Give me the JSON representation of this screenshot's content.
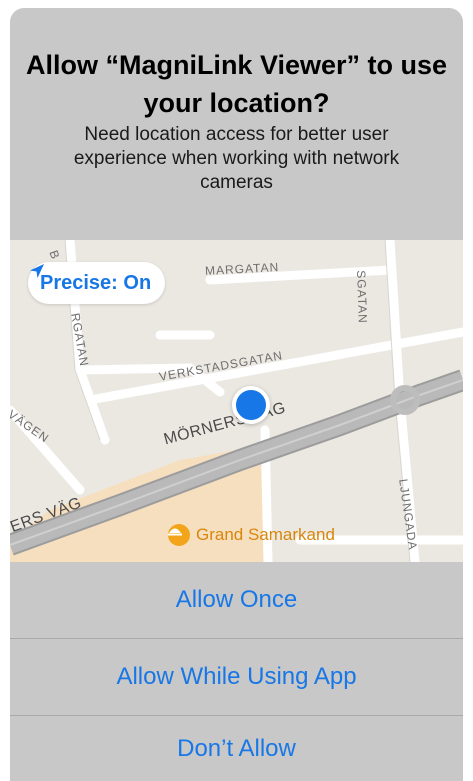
{
  "dialog": {
    "title": "Allow “MagniLink Viewer” to use your location?",
    "message": "Need location access for better user experience when working with network cameras"
  },
  "map": {
    "precise_label": "Precise: On",
    "streets": {
      "margatan": "MARGATAN",
      "sgatan": "SGATAN",
      "rgatan": "RGATAN",
      "b": "B",
      "verkstadsgatan": "VERKSTADSGATAN",
      "vagen": "SVÄGEN",
      "morners_vag": "MÖRNERS VÄG",
      "ers_vag": "ERS VÄG",
      "ljungada": "LJUNGADA"
    },
    "poi_label": "Grand Samarkand",
    "colors": {
      "accent": "#1877e6",
      "poi": "#f2a51a"
    }
  },
  "buttons": {
    "allow_once": "Allow Once",
    "allow_while_using": "Allow While Using App",
    "dont_allow": "Don’t Allow"
  }
}
